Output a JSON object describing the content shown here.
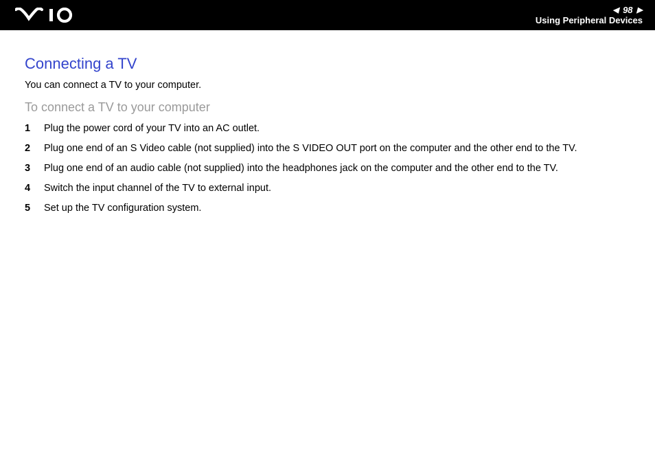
{
  "header": {
    "page_number": "98",
    "section": "Using Peripheral Devices"
  },
  "content": {
    "title": "Connecting a TV",
    "intro": "You can connect a TV to your computer.",
    "subtitle": "To connect a TV to your computer",
    "steps": [
      "Plug the power cord of your TV into an AC outlet.",
      "Plug one end of an S Video cable (not supplied) into the S VIDEO OUT port on the computer and the other end to the TV.",
      "Plug one end of an audio cable (not supplied) into the headphones jack on the computer and the other end to the TV.",
      "Switch the input channel of the TV to external input.",
      "Set up the TV configuration system."
    ]
  }
}
